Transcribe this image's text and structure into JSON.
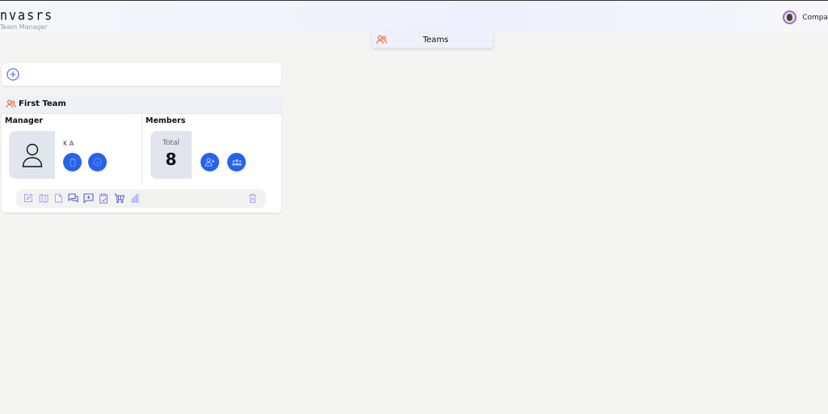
{
  "header": {
    "logo": "nvasrs",
    "subtitle": "Team Manager",
    "user_label": "Compa"
  },
  "nav": {
    "active_tab": "Teams"
  },
  "team": {
    "name": "First Team",
    "manager_heading": "Manager",
    "manager_name": "K A",
    "members_heading": "Members",
    "total_label": "Total",
    "total_value": "8"
  },
  "colors": {
    "accent": "#2563eb",
    "orange": "#f26b3a",
    "icon_muted": "#9aa2f0"
  }
}
